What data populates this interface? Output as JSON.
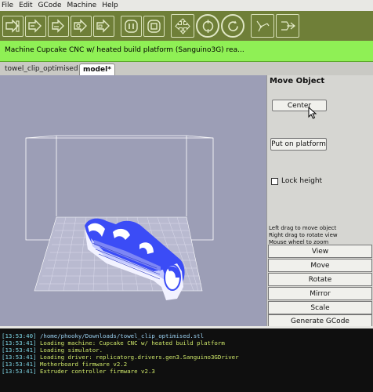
{
  "menu": [
    "File",
    "Edit",
    "GCode",
    "Machine",
    "Help"
  ],
  "toolbar": {
    "buttons": [
      "connect-icon",
      "disconnect-icon",
      "upload-icon",
      "download-icon",
      "move-to-origin-icon",
      "pause-icon",
      "stop-icon",
      "jog-control-icon",
      "reset-icon",
      "rotate-icon",
      "extruder-icon"
    ]
  },
  "machine_status": "Machine Cupcake CNC w/ heated build platform (Sanguino3G) rea...",
  "tabs": [
    {
      "label": "towel_clip_optimised",
      "active": false
    },
    {
      "label": "model*",
      "active": true
    }
  ],
  "panel": {
    "title": "Move Object",
    "center_label": "Center",
    "platform_label": "Put on platform",
    "lock_label": "Lock height",
    "lock_checked": false,
    "help": [
      "Left drag to move object",
      "Right drag to rotate view",
      "Mouse wheel to zoom"
    ],
    "buttons": [
      "View",
      "Move",
      "Rotate",
      "Mirror",
      "Scale",
      "Generate GCode"
    ]
  },
  "console": [
    {
      "ts": "[13:53:40]",
      "msg": "/home/phooky/Downloads/towel_clip_optimised.stl",
      "kind": "path"
    },
    {
      "ts": "[13:53:41]",
      "msg": "Loading machine: Cupcake CNC w/ heated build platform",
      "kind": "ok"
    },
    {
      "ts": "[13:53:41]",
      "msg": "Loading simulator.",
      "kind": "ok"
    },
    {
      "ts": "[13:53:41]",
      "msg": "Loading driver: replicatorg.drivers.gen3.Sanguino3GDriver",
      "kind": "ok"
    },
    {
      "ts": "[13:53:41]",
      "msg": "Motherboard firmware v2.2",
      "kind": "ok"
    },
    {
      "ts": "[13:53:41]",
      "msg": "Extruder controller firmware v2.3",
      "kind": "ok"
    }
  ],
  "colors": {
    "toolbar": "#6f7f38",
    "status_bar": "#8ff055",
    "viewport_bg": "#9c9eb6",
    "model": "#4c5cff",
    "console_bg": "#0f0f0f"
  }
}
